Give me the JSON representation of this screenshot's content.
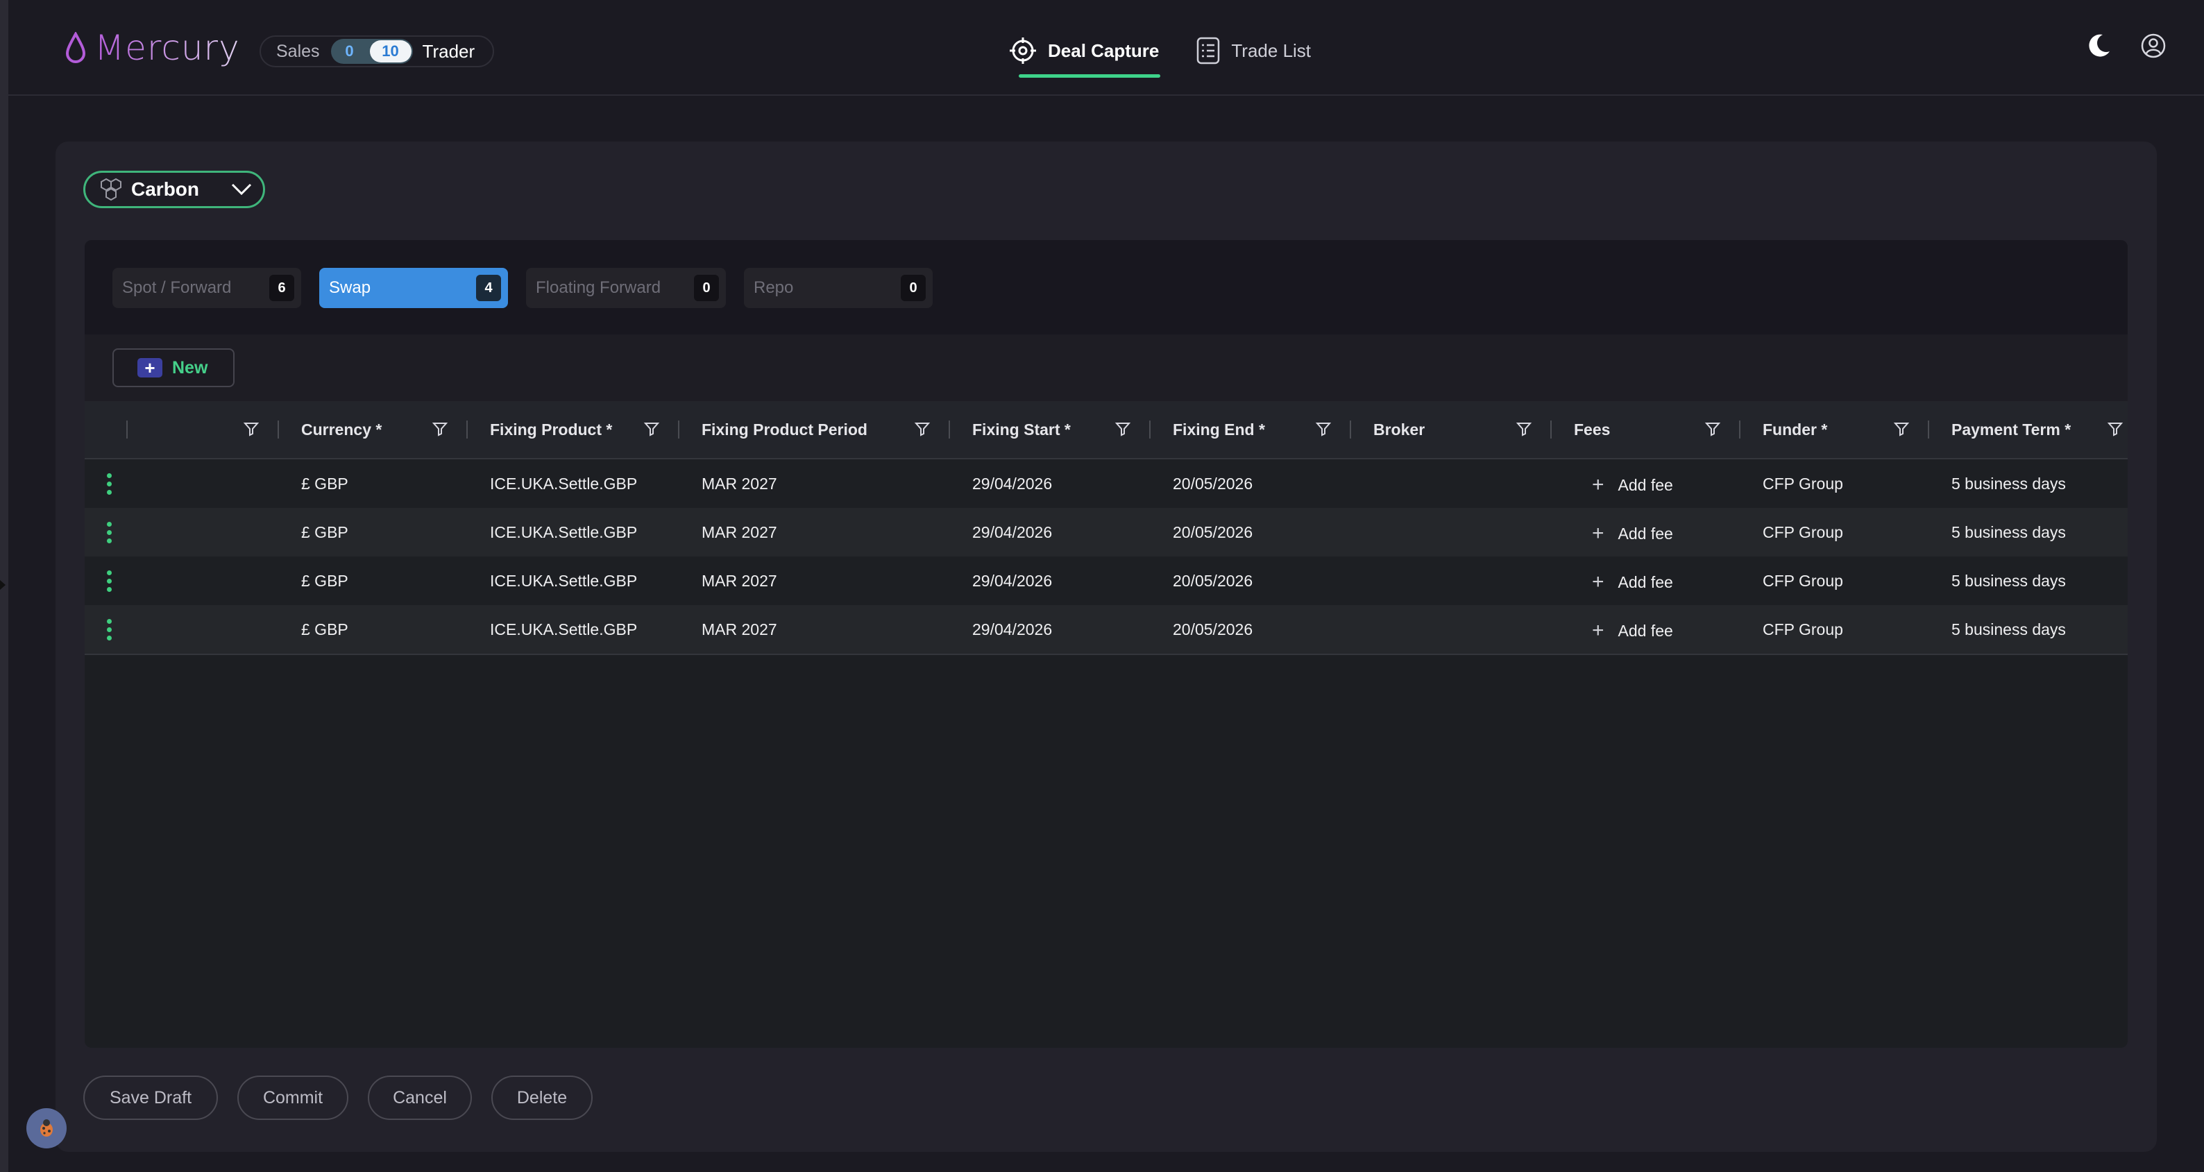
{
  "app": {
    "name": "Mercury"
  },
  "mode_toggle": {
    "left_label": "Sales",
    "left_count": "0",
    "right_count": "10",
    "right_label": "Trader"
  },
  "nav": {
    "items": [
      {
        "label": "Deal Capture",
        "icon": "crosshair-icon",
        "active": true
      },
      {
        "label": "Trade List",
        "icon": "list-icon",
        "active": false
      }
    ]
  },
  "header_icons": [
    "moon-icon",
    "user-circle-icon"
  ],
  "asset_selector": {
    "label": "Carbon",
    "icon": "hexagons-icon"
  },
  "tabs": [
    {
      "label": "Spot / Forward",
      "count": "6"
    },
    {
      "label": "Swap",
      "count": "4"
    },
    {
      "label": "Floating Forward",
      "count": "0"
    },
    {
      "label": "Repo",
      "count": "0"
    }
  ],
  "active_tab": "Swap",
  "toolbar": {
    "new_label": "New"
  },
  "table": {
    "columns": [
      "",
      "Currency *",
      "Fixing Product *",
      "Fixing Product Period",
      "Fixing Start *",
      "Fixing End *",
      "Broker",
      "Fees",
      "Funder *",
      "Payment Term *"
    ],
    "add_fee_label": "Add fee",
    "rows": [
      {
        "currency": "£ GBP",
        "fixing_product": "ICE.UKA.Settle.GBP",
        "period": "MAR 2027",
        "start": "29/04/2026",
        "end": "20/05/2026",
        "broker": "",
        "funder": "CFP Group",
        "payment_term": "5 business days"
      },
      {
        "currency": "£ GBP",
        "fixing_product": "ICE.UKA.Settle.GBP",
        "period": "MAR 2027",
        "start": "29/04/2026",
        "end": "20/05/2026",
        "broker": "",
        "funder": "CFP Group",
        "payment_term": "5 business days"
      },
      {
        "currency": "£ GBP",
        "fixing_product": "ICE.UKA.Settle.GBP",
        "period": "MAR 2027",
        "start": "29/04/2026",
        "end": "20/05/2026",
        "broker": "",
        "funder": "CFP Group",
        "payment_term": "5 business days"
      },
      {
        "currency": "£ GBP",
        "fixing_product": "ICE.UKA.Settle.GBP",
        "period": "MAR 2027",
        "start": "29/04/2026",
        "end": "20/05/2026",
        "broker": "",
        "funder": "CFP Group",
        "payment_term": "5 business days"
      }
    ]
  },
  "footer": {
    "save_draft": "Save Draft",
    "commit": "Commit",
    "cancel": "Cancel",
    "delete": "Delete"
  },
  "colors": {
    "accent_green": "#3ed38a",
    "active_tab_blue": "#3b8de0",
    "background": "#1b1a22"
  }
}
